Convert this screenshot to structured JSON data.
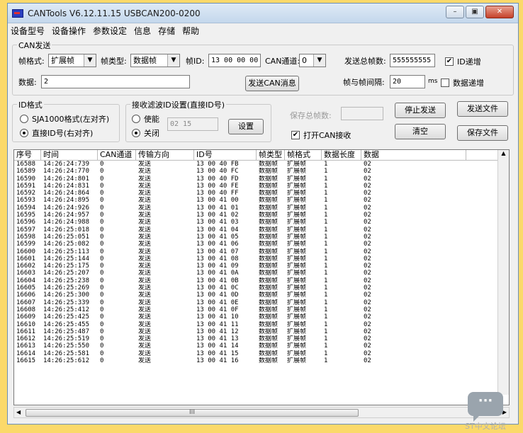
{
  "window": {
    "title": "CANTools V6.12.11.15  USBCAN200-0200",
    "buttons": {
      "minimize": "–",
      "maximize": "▣",
      "close": "✕"
    }
  },
  "menu": [
    "设备型号",
    "设备操作",
    "参数设定",
    "信息",
    "存储",
    "帮助"
  ],
  "can_send": {
    "group_label": "CAN发送",
    "frame_format_label": "帧格式:",
    "frame_format_value": "扩展帧",
    "frame_type_label": "帧类型:",
    "frame_type_value": "数据帧",
    "frame_id_label": "帧ID:",
    "frame_id_value": "13 00 00 00",
    "can_channel_label": "CAN通道:",
    "can_channel_value": "0",
    "total_frames_label": "发送总帧数:",
    "total_frames_value": "555555555",
    "id_increment_label": "ID递增",
    "id_increment_checked": true,
    "data_label": "数据:",
    "data_value": "2",
    "send_button": "发送CAN消息",
    "frame_interval_label": "帧与帧间隔:",
    "frame_interval_value": "20",
    "frame_interval_unit": "ms",
    "data_increment_label": "数据递增",
    "data_increment_checked": false
  },
  "id_format": {
    "group_label": "ID格式",
    "option1": "SJA1000格式(左对齐)",
    "option2": "直接ID号(右对齐)",
    "selected": 2
  },
  "filter": {
    "group_label": "接收滤波ID设置(直接ID号)",
    "enable_label": "使能",
    "disable_label": "关闭",
    "selected": "disable",
    "id_value": "02 15",
    "set_button": "设置"
  },
  "right_panel": {
    "save_total_label": "保存总帧数:",
    "stop_send_button": "停止发送",
    "send_file_button": "发送文件",
    "open_can_receive_label": "打开CAN接收",
    "open_can_receive_checked": true,
    "clear_button": "清空",
    "save_file_button": "保存文件"
  },
  "table": {
    "columns": [
      "序号",
      "时间",
      "CAN通道",
      "传输方向",
      "ID号",
      "帧类型",
      "帧格式",
      "数据长度",
      "数据"
    ],
    "rows": [
      [
        "16588",
        "14:26:24:739",
        "0",
        "发送",
        "13 00 40 FB",
        "数据帧",
        "扩展帧",
        "1",
        "02"
      ],
      [
        "16589",
        "14:26:24:770",
        "0",
        "发送",
        "13 00 40 FC",
        "数据帧",
        "扩展帧",
        "1",
        "02"
      ],
      [
        "16590",
        "14:26:24:801",
        "0",
        "发送",
        "13 00 40 FD",
        "数据帧",
        "扩展帧",
        "1",
        "02"
      ],
      [
        "16591",
        "14:26:24:831",
        "0",
        "发送",
        "13 00 40 FE",
        "数据帧",
        "扩展帧",
        "1",
        "02"
      ],
      [
        "16592",
        "14:26:24:864",
        "0",
        "发送",
        "13 00 40 FF",
        "数据帧",
        "扩展帧",
        "1",
        "02"
      ],
      [
        "16593",
        "14:26:24:895",
        "0",
        "发送",
        "13 00 41 00",
        "数据帧",
        "扩展帧",
        "1",
        "02"
      ],
      [
        "16594",
        "14:26:24:926",
        "0",
        "发送",
        "13 00 41 01",
        "数据帧",
        "扩展帧",
        "1",
        "02"
      ],
      [
        "16595",
        "14:26:24:957",
        "0",
        "发送",
        "13 00 41 02",
        "数据帧",
        "扩展帧",
        "1",
        "02"
      ],
      [
        "16596",
        "14:26:24:988",
        "0",
        "发送",
        "13 00 41 03",
        "数据帧",
        "扩展帧",
        "1",
        "02"
      ],
      [
        "16597",
        "14:26:25:018",
        "0",
        "发送",
        "13 00 41 04",
        "数据帧",
        "扩展帧",
        "1",
        "02"
      ],
      [
        "16598",
        "14:26:25:051",
        "0",
        "发送",
        "13 00 41 05",
        "数据帧",
        "扩展帧",
        "1",
        "02"
      ],
      [
        "16599",
        "14:26:25:082",
        "0",
        "发送",
        "13 00 41 06",
        "数据帧",
        "扩展帧",
        "1",
        "02"
      ],
      [
        "16600",
        "14:26:25:113",
        "0",
        "发送",
        "13 00 41 07",
        "数据帧",
        "扩展帧",
        "1",
        "02"
      ],
      [
        "16601",
        "14:26:25:144",
        "0",
        "发送",
        "13 00 41 08",
        "数据帧",
        "扩展帧",
        "1",
        "02"
      ],
      [
        "16602",
        "14:26:25:175",
        "0",
        "发送",
        "13 00 41 09",
        "数据帧",
        "扩展帧",
        "1",
        "02"
      ],
      [
        "16603",
        "14:26:25:207",
        "0",
        "发送",
        "13 00 41 0A",
        "数据帧",
        "扩展帧",
        "1",
        "02"
      ],
      [
        "16604",
        "14:26:25:238",
        "0",
        "发送",
        "13 00 41 0B",
        "数据帧",
        "扩展帧",
        "1",
        "02"
      ],
      [
        "16605",
        "14:26:25:269",
        "0",
        "发送",
        "13 00 41 0C",
        "数据帧",
        "扩展帧",
        "1",
        "02"
      ],
      [
        "16606",
        "14:26:25:300",
        "0",
        "发送",
        "13 00 41 0D",
        "数据帧",
        "扩展帧",
        "1",
        "02"
      ],
      [
        "16607",
        "14:26:25:339",
        "0",
        "发送",
        "13 00 41 0E",
        "数据帧",
        "扩展帧",
        "1",
        "02"
      ],
      [
        "16608",
        "14:26:25:412",
        "0",
        "发送",
        "13 00 41 0F",
        "数据帧",
        "扩展帧",
        "1",
        "02"
      ],
      [
        "16609",
        "14:26:25:425",
        "0",
        "发送",
        "13 00 41 10",
        "数据帧",
        "扩展帧",
        "1",
        "02"
      ],
      [
        "16610",
        "14:26:25:455",
        "0",
        "发送",
        "13 00 41 11",
        "数据帧",
        "扩展帧",
        "1",
        "02"
      ],
      [
        "16611",
        "14:26:25:487",
        "0",
        "发送",
        "13 00 41 12",
        "数据帧",
        "扩展帧",
        "1",
        "02"
      ],
      [
        "16612",
        "14:26:25:519",
        "0",
        "发送",
        "13 00 41 13",
        "数据帧",
        "扩展帧",
        "1",
        "02"
      ],
      [
        "16613",
        "14:26:25:550",
        "0",
        "发送",
        "13 00 41 14",
        "数据帧",
        "扩展帧",
        "1",
        "02"
      ],
      [
        "16614",
        "14:26:25:581",
        "0",
        "发送",
        "13 00 41 15",
        "数据帧",
        "扩展帧",
        "1",
        "02"
      ],
      [
        "16615",
        "14:26:25:612",
        "0",
        "发送",
        "13 00 41 16",
        "数据帧",
        "扩展帧",
        "1",
        "02"
      ]
    ]
  },
  "scrollbar": {
    "thumb_grip": "III"
  },
  "watermark": {
    "text": "ST中文论坛",
    "bubble": "···"
  },
  "colors": {
    "table_text": "#000000",
    "title_gradient": "#c4d7ec",
    "background": "#fbd96a"
  }
}
